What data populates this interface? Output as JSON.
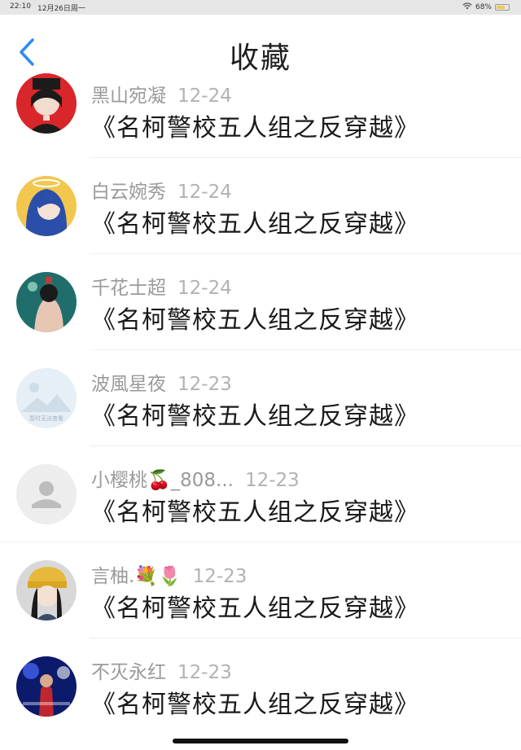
{
  "status_bar": {
    "time": "22:10",
    "date": "12月26日周一",
    "battery": "68%",
    "battery_level": 0.68,
    "icons": [
      "wifi-icon",
      "battery-icon"
    ]
  },
  "nav": {
    "title": "收藏",
    "back_icon": "chevron-left-icon",
    "accent_color": "#2d8cf0"
  },
  "items": [
    {
      "name": "黑山宛凝",
      "date": "12-24",
      "title": "《名柯警校五人组之反穿越》",
      "avatar": "anime-avatar-red"
    },
    {
      "name": "白云婉秀",
      "date": "12-24",
      "title": "《名柯警校五人组之反穿越》",
      "avatar": "anime-avatar-yellow"
    },
    {
      "name": "千花士超",
      "date": "12-24",
      "title": "《名柯警校五人组之反穿越》",
      "avatar": "anime-avatar-teal"
    },
    {
      "name": "波風星夜",
      "date": "12-23",
      "title": "《名柯警校五人组之反穿越》",
      "avatar": "image-unavailable-avatar",
      "avatar_text": "暂时无法查看"
    },
    {
      "name": "小樱桃🍒_808...",
      "date": "12-23",
      "title": "《名柯警校五人组之反穿越》",
      "avatar": "default-user-avatar"
    },
    {
      "name": "言柚.💐🌷",
      "date": "12-23",
      "title": "《名柯警校五人组之反穿越》",
      "avatar": "anime-avatar-hat"
    },
    {
      "name": "不灭永红",
      "date": "12-23",
      "title": "《名柯警校五人组之反穿越》",
      "avatar": "concert-avatar"
    }
  ]
}
